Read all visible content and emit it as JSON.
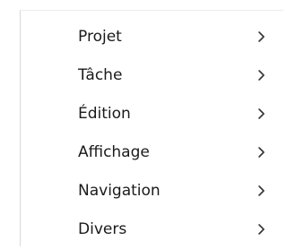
{
  "menu": {
    "items": [
      {
        "label": "Projet",
        "icon": "chevron-right-icon"
      },
      {
        "label": "Tâche",
        "icon": "chevron-right-icon"
      },
      {
        "label": "Édition",
        "icon": "chevron-right-icon"
      },
      {
        "label": "Affichage",
        "icon": "chevron-right-icon"
      },
      {
        "label": "Navigation",
        "icon": "chevron-right-icon"
      },
      {
        "label": "Divers",
        "icon": "chevron-right-icon"
      }
    ]
  },
  "colors": {
    "text": "#1a1a1a",
    "chevron": "#333333",
    "border": "#d9d9d9",
    "background": "#ffffff"
  }
}
